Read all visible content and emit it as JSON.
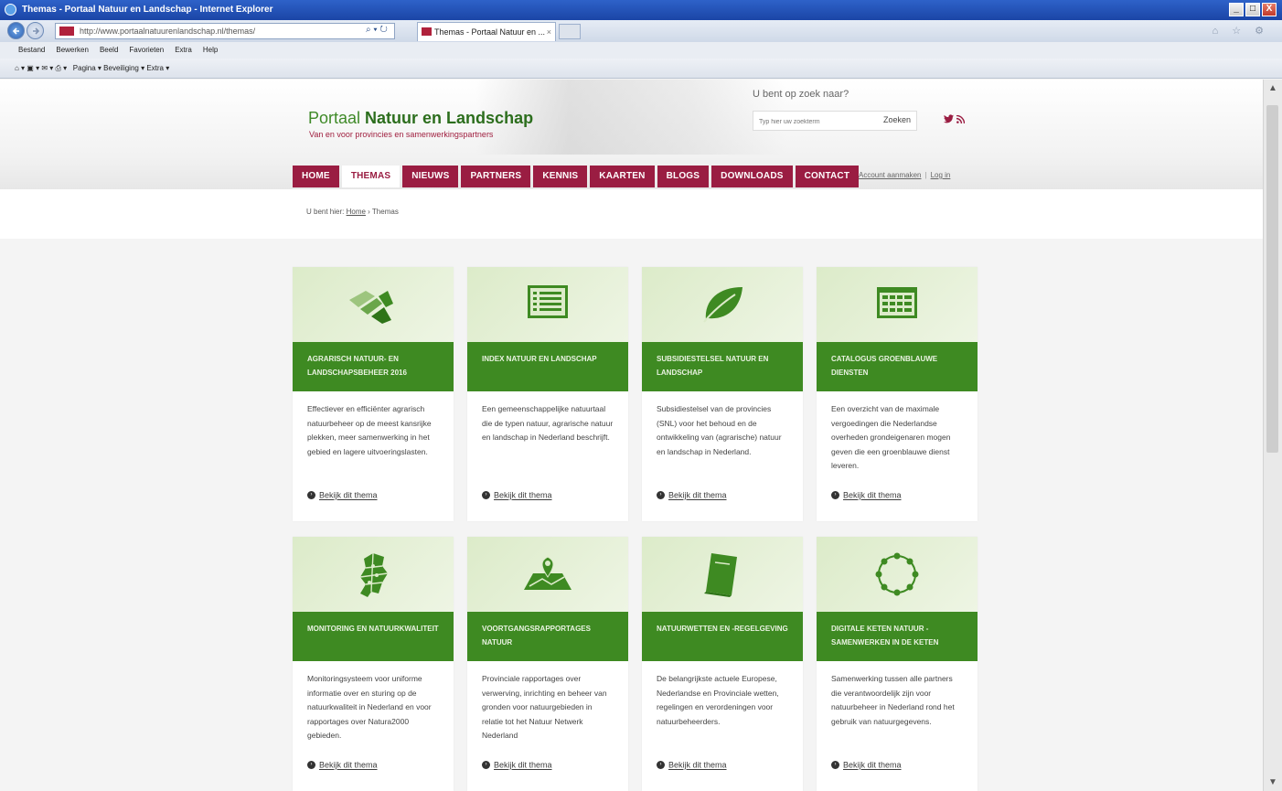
{
  "window": {
    "title": "Themas - Portaal Natuur en Landschap - Internet Explorer",
    "buttons": [
      "_",
      "□",
      "X"
    ]
  },
  "browser": {
    "address": "http://www.portaalnatuurenlandschap.nl/themas/",
    "tab_title": "Themas - Portaal Natuur en ...",
    "tab_close": "×",
    "menu": [
      "Bestand",
      "Bewerken",
      "Beeld",
      "Favorieten",
      "Extra",
      "Help"
    ],
    "commandbar": "Pagina ▾   Beveiliging ▾   Extra ▾",
    "nav_right": "⌂ ☆ ⚙"
  },
  "site": {
    "logo_prefix": "Portaal ",
    "logo_bold": "Natuur en Landschap",
    "logo_subtitle": "Van en voor provincies en samenwerkingspartners",
    "search_label": "U bent op zoek naar?",
    "search_placeholder": "Typ hier uw zoekterm",
    "search_button": "Zoeken",
    "social": "🐦 ◉",
    "nav": [
      "HOME",
      "THEMAS",
      "NIEUWS",
      "PARTNERS",
      "KENNIS",
      "KAARTEN",
      "BLOGS",
      "DOWNLOADS",
      "CONTACT"
    ],
    "nav_active": "THEMAS",
    "account_create": "Account aanmaken",
    "account_login": "Log in",
    "account_sep": "|"
  },
  "breadcrumb": {
    "prefix": "U bent hier:",
    "home": "Home",
    "sep": "›",
    "current": "Themas"
  },
  "cards": [
    {
      "icon": "agri-fields-icon",
      "title": "Agrarisch natuur- en landschapsbeheer 2016",
      "desc": "Effectiever en efficiënter agrarisch natuurbeheer op de meest kansrijke plekken, meer samenwerking in het gebied en lagere uitvoeringslasten.",
      "link": "Bekijk dit thema"
    },
    {
      "icon": "index-list-icon",
      "title": "Index Natuur en Landschap",
      "desc": "Een gemeenschappelijke natuurtaal die de typen natuur, agrarische natuur en landschap in Nederland beschrijft.",
      "link": "Bekijk dit thema"
    },
    {
      "icon": "leaf-icon",
      "title": "Subsidiestelsel Natuur en Landschap",
      "desc": "Subsidiestelsel van de provincies (SNL) voor het behoud en de ontwikkeling van (agrarische) natuur en landschap in Nederland.",
      "link": "Bekijk dit thema"
    },
    {
      "icon": "catalogue-grid-icon",
      "title": "Catalogus groenblauwe diensten",
      "desc": "Een overzicht van de maximale vergoedingen die Nederlandse overheden grondeigenaren mogen geven die een groenblauwe dienst leveren.",
      "link": "Bekijk dit thema"
    },
    {
      "icon": "netherlands-map-icon",
      "title": "Monitoring en natuurkwaliteit",
      "desc": "Monitoringsysteem voor uniforme informatie over en sturing op de natuurkwaliteit in Nederland en voor rapportages over Natura2000 gebieden.",
      "link": "Bekijk dit thema"
    },
    {
      "icon": "map-pin-icon",
      "title": "Voortgangsrapportages natuur",
      "desc": "Provinciale rapportages over verwerving, inrichting en beheer van gronden voor natuurgebieden in relatie tot het Natuur Netwerk Nederland",
      "link": "Bekijk dit thema"
    },
    {
      "icon": "law-book-icon",
      "title": "Natuurwetten en -regelgeving",
      "desc": "De belangrijkste actuele Europese, Nederlandse en Provinciale wetten, regelingen en verordeningen voor natuurbeheerders.",
      "link": "Bekijk dit thema"
    },
    {
      "icon": "network-circle-icon",
      "title": "Digitale keten natuur - samenwerken in de keten",
      "desc": "Samenwerking tussen alle partners die verantwoordelijk zijn voor natuurbeheer in Nederland rond het gebruik van natuurgegevens.",
      "link": "Bekijk dit thema"
    }
  ],
  "colors": {
    "brand_red": "#9a1d42",
    "brand_green": "#3e8a22",
    "card_top": "#dcebc9"
  }
}
